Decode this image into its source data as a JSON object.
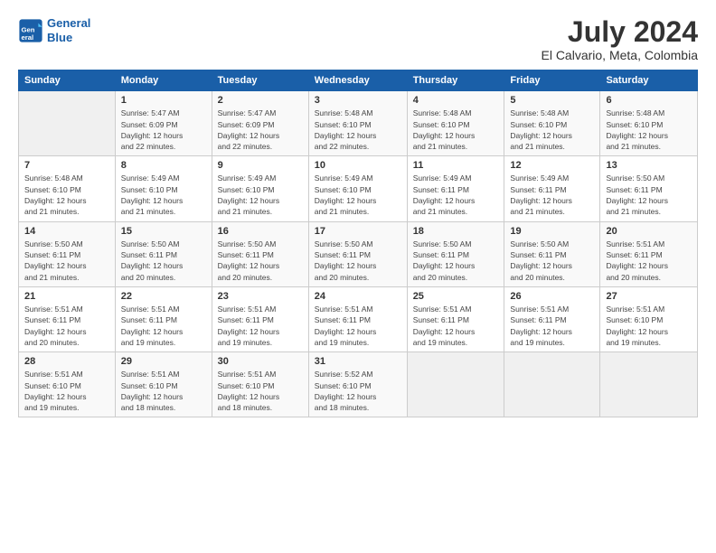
{
  "header": {
    "logo_line1": "General",
    "logo_line2": "Blue",
    "title": "July 2024",
    "subtitle": "El Calvario, Meta, Colombia"
  },
  "columns": [
    "Sunday",
    "Monday",
    "Tuesday",
    "Wednesday",
    "Thursday",
    "Friday",
    "Saturday"
  ],
  "weeks": [
    [
      {
        "day": "",
        "detail": ""
      },
      {
        "day": "1",
        "detail": "Sunrise: 5:47 AM\nSunset: 6:09 PM\nDaylight: 12 hours\nand 22 minutes."
      },
      {
        "day": "2",
        "detail": "Sunrise: 5:47 AM\nSunset: 6:09 PM\nDaylight: 12 hours\nand 22 minutes."
      },
      {
        "day": "3",
        "detail": "Sunrise: 5:48 AM\nSunset: 6:10 PM\nDaylight: 12 hours\nand 22 minutes."
      },
      {
        "day": "4",
        "detail": "Sunrise: 5:48 AM\nSunset: 6:10 PM\nDaylight: 12 hours\nand 21 minutes."
      },
      {
        "day": "5",
        "detail": "Sunrise: 5:48 AM\nSunset: 6:10 PM\nDaylight: 12 hours\nand 21 minutes."
      },
      {
        "day": "6",
        "detail": "Sunrise: 5:48 AM\nSunset: 6:10 PM\nDaylight: 12 hours\nand 21 minutes."
      }
    ],
    [
      {
        "day": "7",
        "detail": "Sunrise: 5:48 AM\nSunset: 6:10 PM\nDaylight: 12 hours\nand 21 minutes."
      },
      {
        "day": "8",
        "detail": "Sunrise: 5:49 AM\nSunset: 6:10 PM\nDaylight: 12 hours\nand 21 minutes."
      },
      {
        "day": "9",
        "detail": "Sunrise: 5:49 AM\nSunset: 6:10 PM\nDaylight: 12 hours\nand 21 minutes."
      },
      {
        "day": "10",
        "detail": "Sunrise: 5:49 AM\nSunset: 6:10 PM\nDaylight: 12 hours\nand 21 minutes."
      },
      {
        "day": "11",
        "detail": "Sunrise: 5:49 AM\nSunset: 6:11 PM\nDaylight: 12 hours\nand 21 minutes."
      },
      {
        "day": "12",
        "detail": "Sunrise: 5:49 AM\nSunset: 6:11 PM\nDaylight: 12 hours\nand 21 minutes."
      },
      {
        "day": "13",
        "detail": "Sunrise: 5:50 AM\nSunset: 6:11 PM\nDaylight: 12 hours\nand 21 minutes."
      }
    ],
    [
      {
        "day": "14",
        "detail": "Sunrise: 5:50 AM\nSunset: 6:11 PM\nDaylight: 12 hours\nand 21 minutes."
      },
      {
        "day": "15",
        "detail": "Sunrise: 5:50 AM\nSunset: 6:11 PM\nDaylight: 12 hours\nand 20 minutes."
      },
      {
        "day": "16",
        "detail": "Sunrise: 5:50 AM\nSunset: 6:11 PM\nDaylight: 12 hours\nand 20 minutes."
      },
      {
        "day": "17",
        "detail": "Sunrise: 5:50 AM\nSunset: 6:11 PM\nDaylight: 12 hours\nand 20 minutes."
      },
      {
        "day": "18",
        "detail": "Sunrise: 5:50 AM\nSunset: 6:11 PM\nDaylight: 12 hours\nand 20 minutes."
      },
      {
        "day": "19",
        "detail": "Sunrise: 5:50 AM\nSunset: 6:11 PM\nDaylight: 12 hours\nand 20 minutes."
      },
      {
        "day": "20",
        "detail": "Sunrise: 5:51 AM\nSunset: 6:11 PM\nDaylight: 12 hours\nand 20 minutes."
      }
    ],
    [
      {
        "day": "21",
        "detail": "Sunrise: 5:51 AM\nSunset: 6:11 PM\nDaylight: 12 hours\nand 20 minutes."
      },
      {
        "day": "22",
        "detail": "Sunrise: 5:51 AM\nSunset: 6:11 PM\nDaylight: 12 hours\nand 19 minutes."
      },
      {
        "day": "23",
        "detail": "Sunrise: 5:51 AM\nSunset: 6:11 PM\nDaylight: 12 hours\nand 19 minutes."
      },
      {
        "day": "24",
        "detail": "Sunrise: 5:51 AM\nSunset: 6:11 PM\nDaylight: 12 hours\nand 19 minutes."
      },
      {
        "day": "25",
        "detail": "Sunrise: 5:51 AM\nSunset: 6:11 PM\nDaylight: 12 hours\nand 19 minutes."
      },
      {
        "day": "26",
        "detail": "Sunrise: 5:51 AM\nSunset: 6:11 PM\nDaylight: 12 hours\nand 19 minutes."
      },
      {
        "day": "27",
        "detail": "Sunrise: 5:51 AM\nSunset: 6:10 PM\nDaylight: 12 hours\nand 19 minutes."
      }
    ],
    [
      {
        "day": "28",
        "detail": "Sunrise: 5:51 AM\nSunset: 6:10 PM\nDaylight: 12 hours\nand 19 minutes."
      },
      {
        "day": "29",
        "detail": "Sunrise: 5:51 AM\nSunset: 6:10 PM\nDaylight: 12 hours\nand 18 minutes."
      },
      {
        "day": "30",
        "detail": "Sunrise: 5:51 AM\nSunset: 6:10 PM\nDaylight: 12 hours\nand 18 minutes."
      },
      {
        "day": "31",
        "detail": "Sunrise: 5:52 AM\nSunset: 6:10 PM\nDaylight: 12 hours\nand 18 minutes."
      },
      {
        "day": "",
        "detail": ""
      },
      {
        "day": "",
        "detail": ""
      },
      {
        "day": "",
        "detail": ""
      }
    ]
  ]
}
